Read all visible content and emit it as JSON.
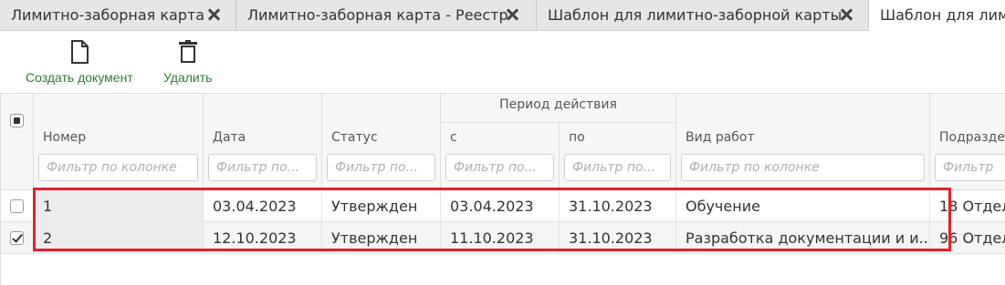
{
  "tabs": [
    {
      "label": "Лимитно-заборная карта"
    },
    {
      "label": "Лимитно-заборная карта - Реестр"
    },
    {
      "label": "Шаблон для лимитно-заборной карты"
    },
    {
      "label": "Шаблон для лимитн"
    }
  ],
  "toolbar": {
    "create_label": "Создать документ",
    "delete_label": "Удалить"
  },
  "grid": {
    "group_header": "Период действия",
    "columns": [
      "Номер",
      "Дата",
      "Статус",
      "с",
      "по",
      "Вид работ",
      "Подразде"
    ],
    "filters": [
      "Фильтр по колонке",
      "Фильтр по...",
      "Фильтр по...",
      "Фильтр по...",
      "Фильтр по...",
      "Фильтр по колонке",
      "Фильтр"
    ],
    "rows": [
      {
        "checked": false,
        "cells": [
          "1",
          "03.04.2023",
          "Утвержден",
          "03.04.2023",
          "31.10.2023",
          "Обучение",
          "18 Отдел"
        ]
      },
      {
        "checked": true,
        "cells": [
          "2",
          "12.10.2023",
          "Утвержден",
          "11.10.2023",
          "31.10.2023",
          "Разработка документации и и...",
          "96 Отдел"
        ]
      }
    ]
  },
  "colors": {
    "accent_green": "#2e7d32",
    "highlight_red": "#e3202a"
  },
  "icons": [
    "file-icon",
    "trash-icon",
    "close-icon"
  ]
}
